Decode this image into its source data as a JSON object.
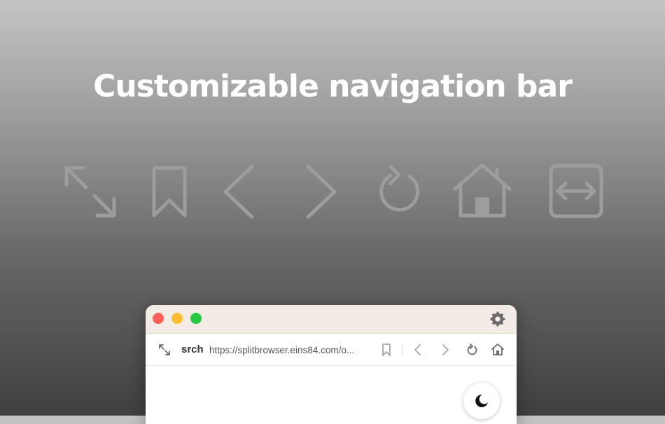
{
  "headline": "Customizable navigation bar",
  "feature_icons": [
    "expand-icon",
    "bookmark-icon",
    "back-icon",
    "forward-icon",
    "reload-icon",
    "home-icon",
    "split-view-icon"
  ],
  "window": {
    "settings_icon": "gear-icon",
    "navbar": {
      "expand_icon": "expand-icon",
      "search_label": "srch",
      "url": "https://splitbrowser.eins84.com/o...",
      "bookmark_icon": "bookmark-icon",
      "back_icon": "chevron-left-icon",
      "forward_icon": "chevron-right-icon",
      "reload_icon": "reload-icon",
      "home_icon": "home-icon"
    },
    "dark_mode_icon": "moon-icon"
  },
  "colors": {
    "close": "#fe5f57",
    "minimize": "#febc2e",
    "zoom": "#28c840",
    "titlebar": "#f3ece4"
  }
}
